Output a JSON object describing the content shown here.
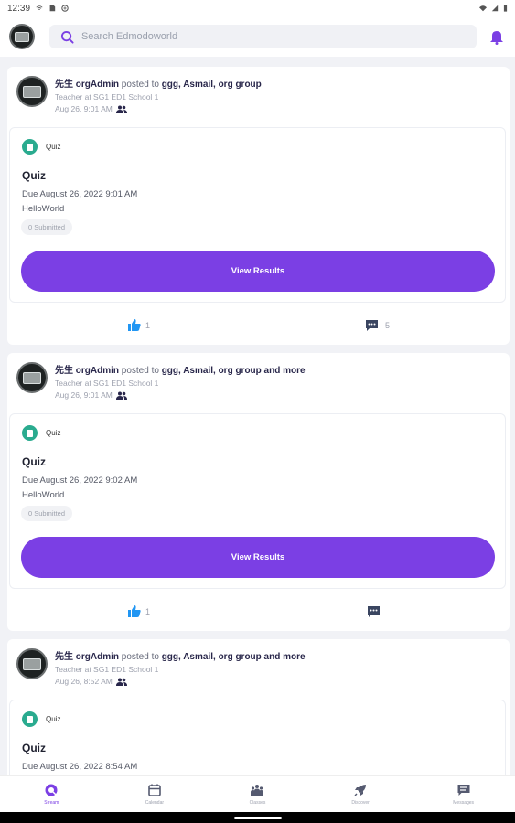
{
  "status_bar": {
    "time": "12:39"
  },
  "search": {
    "placeholder": "Search Edmodoworld"
  },
  "posts": [
    {
      "author": "先生 orgAdmin",
      "posted_to_text": " posted to ",
      "groups": "ggg, Asmail, org group",
      "role": "Teacher at SG1 ED1 School 1",
      "date": "Aug 26, 9:01 AM",
      "quiz": {
        "type_label": "Quiz",
        "title": "Quiz",
        "due": "Due August 26, 2022 9:01 AM",
        "description": "HelloWorld",
        "submitted": "0 Submitted",
        "button": "View Results"
      },
      "likes": "1",
      "comments": "5"
    },
    {
      "author": "先生 orgAdmin",
      "posted_to_text": " posted to ",
      "groups": "ggg, Asmail, org group and more",
      "role": "Teacher at SG1 ED1 School 1",
      "date": "Aug 26, 9:01 AM",
      "quiz": {
        "type_label": "Quiz",
        "title": "Quiz",
        "due": "Due August 26, 2022 9:02 AM",
        "description": "HelloWorld",
        "submitted": "0 Submitted",
        "button": "View Results"
      },
      "likes": "1",
      "comments": ""
    },
    {
      "author": "先生 orgAdmin",
      "posted_to_text": " posted to ",
      "groups": "ggg, Asmail, org group and more",
      "role": "Teacher at SG1 ED1 School 1",
      "date": "Aug 26, 8:52 AM",
      "quiz": {
        "type_label": "Quiz",
        "title": "Quiz",
        "due": "Due August 26, 2022 8:54 AM"
      }
    }
  ],
  "bottom_nav": [
    {
      "label": "Stream",
      "icon": "stream-icon",
      "active": true
    },
    {
      "label": "Calendar",
      "icon": "calendar-icon",
      "active": false
    },
    {
      "label": "Classes",
      "icon": "classes-icon",
      "active": false
    },
    {
      "label": "Discover",
      "icon": "rocket-icon",
      "active": false
    },
    {
      "label": "Messages",
      "icon": "messages-icon",
      "active": false
    }
  ],
  "colors": {
    "accent": "#7b3fe4",
    "quiz_icon": "#2aab8f",
    "like_blue": "#2196f3"
  }
}
